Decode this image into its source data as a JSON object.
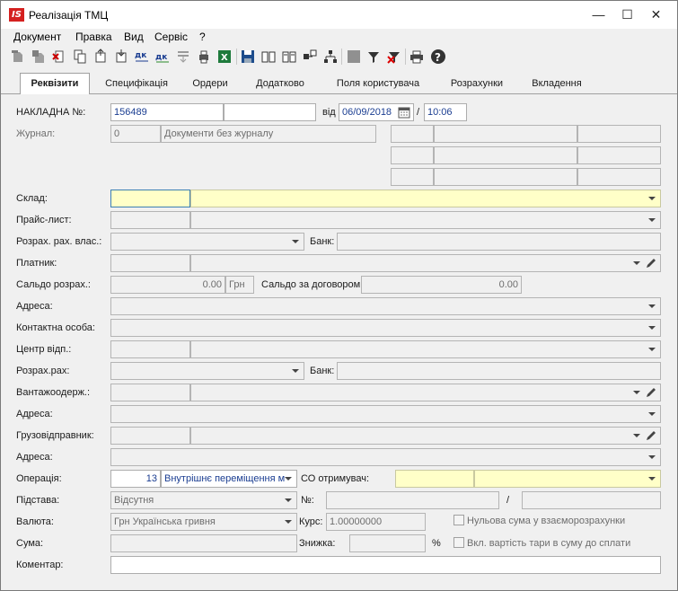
{
  "window": {
    "title": "Реалізація ТМЦ",
    "app_icon_text": "IS",
    "minimize": "—",
    "maximize": "☐",
    "close": "✕"
  },
  "menu": [
    "Документ",
    "Правка",
    "Вид",
    "Сервіс",
    "?"
  ],
  "toolbar_icons": [
    "new-doc-icon",
    "new-copy-icon",
    "delete-icon",
    "copy-icon",
    "export-icon",
    "import-icon",
    "debit-credit-icon",
    "debit-credit-alt-icon",
    "move-down-icon",
    "print-preview-icon",
    "excel-icon",
    "save-icon",
    "open-book-icon",
    "book-icon",
    "link-icon",
    "tree-icon",
    "gray-square-icon",
    "filter-icon",
    "clear-filter-icon",
    "printer-icon",
    "help-icon"
  ],
  "tabs": [
    "Реквізити",
    "Специфікація",
    "Ордери",
    "Додатково",
    "Поля користувача",
    "Розрахунки",
    "Вкладення"
  ],
  "form": {
    "invoice_label": "НАКЛАДНА №:",
    "invoice_number": "156489",
    "from_label": "від",
    "date": "06/09/2018",
    "slash": "/",
    "time": "10:06",
    "journal_label": "Журнал:",
    "journal_code": "0",
    "journal_name": "Документи без журналу",
    "warehouse_label": "Склад:",
    "pricelist_label": "Прайс-лист:",
    "own_account_label": "Розрах. рах. влас.:",
    "bank_label": "Банк:",
    "payer_label": "Платник:",
    "balance_label": "Сальдо розрах.:",
    "balance_value": "0.00",
    "currency_short": "Грн",
    "contract_balance_label": "Сальдо за договором",
    "contract_balance_value": "0.00",
    "address_label": "Адреса:",
    "contact_label": "Контактна особа:",
    "center_label": "Центр відп.:",
    "account_label": "Розрах.рах:",
    "bank2_label": "Банк:",
    "consignee_label": "Вантажоодерж.:",
    "address2_label": "Адреса:",
    "shipper_label": "Грузовідправник:",
    "address3_label": "Адреса:",
    "operation_label": "Операція:",
    "operation_code": "13",
    "operation_name": "Внутрішнє переміщення м",
    "co_receiver_label": "СО отримувач:",
    "basis_label": "Підстава:",
    "basis_value": "Відсутня",
    "number_label": "№:",
    "currency_label": "Валюта:",
    "currency_value": "Грн Українська гривня",
    "rate_label": "Курс:",
    "rate_value": "1.00000000",
    "zero_sum_label": "Нульова сума у взаєморозрахунки",
    "sum_label": "Сума:",
    "discount_label": "Знижка:",
    "percent": "%",
    "tare_label": "Вкл. вартість тари в суму до сплати",
    "comment_label": "Коментар:"
  }
}
